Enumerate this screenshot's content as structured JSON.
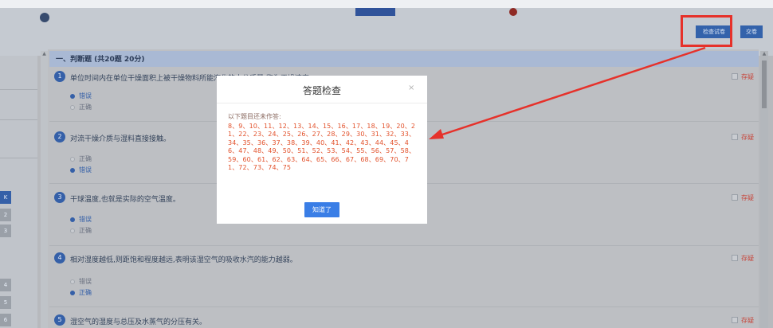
{
  "header": {
    "check_button": "检查试卷",
    "submit_button": "交卷"
  },
  "section": {
    "title": "一、判断题 (共20题 20分)"
  },
  "left_panel": {
    "buttons": [
      "K",
      "2",
      "3",
      "4",
      "5",
      "6"
    ]
  },
  "questions": [
    {
      "num": "1",
      "text": "单位时间内在单位干燥面积上被干燥物料所能汽化的水分质量,称为干燥速率。",
      "mark": "存疑",
      "options": [
        {
          "label": "错误",
          "selected": true
        },
        {
          "label": "正确",
          "selected": false
        }
      ]
    },
    {
      "num": "2",
      "text": "对流干燥介质与湿料直接接触。",
      "mark": "存疑",
      "options": [
        {
          "label": "正确",
          "selected": false
        },
        {
          "label": "错误",
          "selected": true
        }
      ]
    },
    {
      "num": "3",
      "text": "干球温度,也就是实际的空气温度。",
      "mark": "存疑",
      "options": [
        {
          "label": "错误",
          "selected": true
        },
        {
          "label": "正确",
          "selected": false
        }
      ]
    },
    {
      "num": "4",
      "text": "相对湿度越低,则距饱和程度越远,表明该湿空气的吸收水汽的能力越弱。",
      "mark": "存疑",
      "options": [
        {
          "label": "错误",
          "selected": false
        },
        {
          "label": "正确",
          "selected": true
        }
      ]
    },
    {
      "num": "5",
      "text": "湿空气的湿度与总压及水蒸气的分压有关。",
      "mark": "存疑",
      "options": []
    }
  ],
  "modal": {
    "title": "答题检查",
    "close_icon": "×",
    "label": "以下题目还未作答:",
    "unanswered": "8、9、10、11、12、13、14、15、16、17、18、19、20、21、22、23、24、25、26、27、28、29、30、31、32、33、34、35、36、37、38、39、40、41、42、43、44、45、46、47、48、49、50、51、52、53、54、55、56、57、58、59、60、61、62、63、64、65、66、67、68、69、70、71、72、73、74、75",
    "ok_button": "知道了"
  },
  "colors": {
    "accent": "#3560a8",
    "highlight": "#e6312a",
    "unanswered_text": "#e2512b",
    "ok_button": "#3a7ee6"
  }
}
